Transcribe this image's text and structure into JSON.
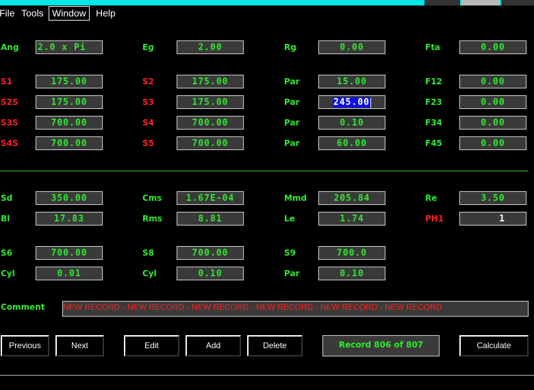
{
  "menu": {
    "file": "File",
    "tools": "Tools",
    "window": "Window",
    "help": "Help"
  },
  "rows": {
    "r1": [
      {
        "label": "Ang",
        "lc": "g",
        "value": "2.0 x Pi",
        "align": "left"
      },
      {
        "label": "Eg",
        "lc": "g",
        "value": "2.00"
      },
      {
        "label": "Rg",
        "lc": "g",
        "value": "0.00"
      },
      {
        "label": "Fta",
        "lc": "g",
        "value": "0.00"
      }
    ],
    "r2": [
      {
        "label": "S1",
        "lc": "r",
        "value": "175.00"
      },
      {
        "label": "S2",
        "lc": "r",
        "value": "175.00"
      },
      {
        "label": "Par",
        "lc": "g",
        "value": "15.00"
      },
      {
        "label": "F12",
        "lc": "g",
        "value": "0.00"
      }
    ],
    "r3": [
      {
        "label": "S2S",
        "lc": "r",
        "value": "175.00"
      },
      {
        "label": "S3",
        "lc": "r",
        "value": "175.00"
      },
      {
        "label": "Par",
        "lc": "g",
        "value": "245.00"
      },
      {
        "label": "F23",
        "lc": "g",
        "value": "0.00"
      }
    ],
    "r4": [
      {
        "label": "S3S",
        "lc": "r",
        "value": "700.00"
      },
      {
        "label": "S4",
        "lc": "r",
        "value": "700.00"
      },
      {
        "label": "Par",
        "lc": "g",
        "value": "0.10"
      },
      {
        "label": "F34",
        "lc": "g",
        "value": "0.00"
      }
    ],
    "r5": [
      {
        "label": "S4S",
        "lc": "r",
        "value": "700.00"
      },
      {
        "label": "S5",
        "lc": "r",
        "value": "700.00"
      },
      {
        "label": "Par",
        "lc": "g",
        "value": "60.00"
      },
      {
        "label": "F45",
        "lc": "g",
        "value": "0.00"
      }
    ],
    "r6": [
      {
        "label": "Sd",
        "lc": "g",
        "value": "350.00"
      },
      {
        "label": "Cms",
        "lc": "g",
        "value": "1.67E-04"
      },
      {
        "label": "Mmd",
        "lc": "g",
        "value": "205.84"
      },
      {
        "label": "Re",
        "lc": "g",
        "value": "3.50"
      }
    ],
    "r7": [
      {
        "label": "Bl",
        "lc": "g",
        "value": "17.83"
      },
      {
        "label": "Rms",
        "lc": "g",
        "value": "8.81"
      },
      {
        "label": "Le",
        "lc": "g",
        "value": "1.74"
      },
      {
        "label": "PH1",
        "lc": "r",
        "value": "1"
      }
    ],
    "r8": [
      {
        "label": "S6",
        "lc": "g",
        "value": "700.00"
      },
      {
        "label": "S8",
        "lc": "g",
        "value": "700.00"
      },
      {
        "label": "S9",
        "lc": "g",
        "value": "700.0"
      }
    ],
    "r9": [
      {
        "label": "Cyl",
        "lc": "g",
        "value": "0.01"
      },
      {
        "label": "Cyl",
        "lc": "g",
        "value": "0.10"
      },
      {
        "label": "Par",
        "lc": "g",
        "value": "0.10"
      }
    ]
  },
  "comment": {
    "label": "Comment",
    "value": "NEW RECORD - NEW RECORD - NEW RECORD - NEW RECORD - NEW RECORD - NEW RECORD"
  },
  "buttons": {
    "previous": "Previous",
    "next": "Next",
    "edit": "Edit",
    "add": "Add",
    "delete": "Delete",
    "calculate": "Calculate"
  },
  "status": "Record 806 of 807",
  "colors": {
    "green": "#2ee82e",
    "red": "#ff2020",
    "title_bar": "#00e5e5",
    "selection": "#1010e6"
  }
}
